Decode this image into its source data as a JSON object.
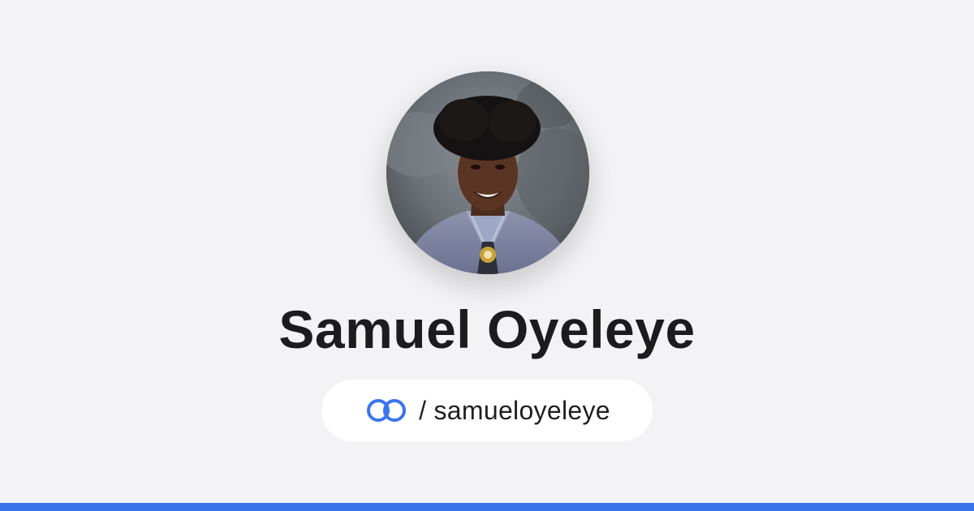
{
  "profile": {
    "name": "Samuel Oyeleye",
    "handle": "/ samueloyeleye",
    "avatar_icon": "profile-photo"
  },
  "brand": {
    "icon": "linked-rings-icon",
    "accent_color": "#3a75ee",
    "background_color": "#f3f3f5"
  }
}
